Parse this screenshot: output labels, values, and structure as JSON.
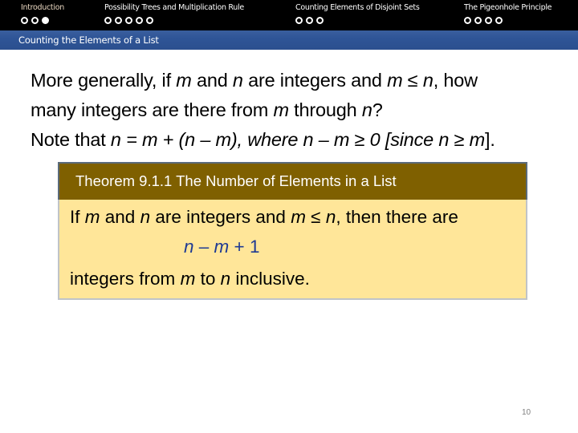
{
  "nav": {
    "sections": [
      {
        "label": "Introduction",
        "dots": 3,
        "filled_index": 2,
        "active": true
      },
      {
        "label": "Possibility Trees and Multiplication Rule",
        "dots": 5,
        "filled_index": -1,
        "active": false
      },
      {
        "label": "Counting Elements of Disjoint Sets",
        "dots": 3,
        "filled_index": -1,
        "active": false
      },
      {
        "label": "The Pigeonhole Principle",
        "dots": 4,
        "filled_index": -1,
        "active": false
      }
    ]
  },
  "frame_title": "Counting the Elements of a List",
  "body": {
    "line1": {
      "t1": "More generally, if ",
      "m1": "m",
      "t2": " and ",
      "n1": "n",
      "t3": " are integers and ",
      "m2": "m",
      "t4": " ≤ ",
      "n2": "n",
      "t5": ", how"
    },
    "line2": {
      "t1": "many integers are there from ",
      "m1": "m",
      "t2": " through ",
      "n1": "n",
      "t3": "?"
    },
    "line3": {
      "t1": "Note that ",
      "i1": "n = m + (n – m), where n – m ≥ 0 [since n ≥ m",
      "t2": "]."
    }
  },
  "theorem": {
    "title": "Theorem 9.1.1 The Number of Elements in a List",
    "line1": {
      "t1": "If ",
      "m1": "m",
      "t2": " and ",
      "n1": "n",
      "t3": " are integers and ",
      "m2": "m",
      "t4": " ≤ ",
      "n2": "n",
      "t5": ", then there are"
    },
    "formula": {
      "n": "n",
      "op1": " – ",
      "m": "m",
      "op2": " + 1"
    },
    "line3": {
      "t1": "integers from ",
      "m1": "m",
      "t2": " to ",
      "n1": "n",
      "t3": " inclusive."
    }
  },
  "colors": {
    "nav_bg": "#000000",
    "title_bar": "#2f5597",
    "theorem_header": "#7f6000",
    "theorem_body": "#ffe699",
    "formula_text": "#1f3a93"
  },
  "page_number": "10"
}
